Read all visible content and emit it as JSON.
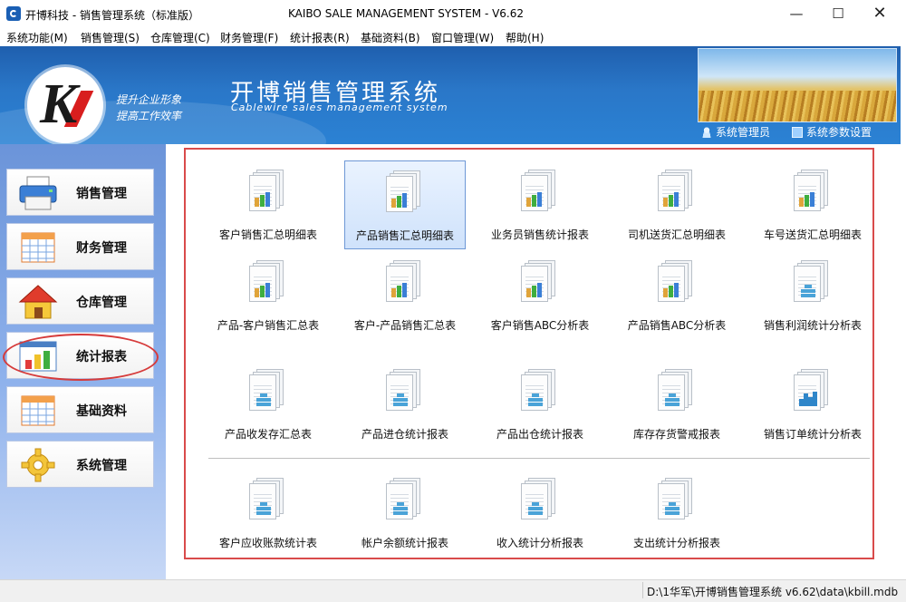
{
  "window": {
    "title_left": "开博科技 - 销售管理系统（标准版）",
    "title_center": "KAIBO SALE MANAGEMENT SYSTEM - V6.62",
    "min_label": "—",
    "max_label": "☐",
    "close_label": "✕"
  },
  "menu": [
    {
      "label": "系统功能(M)"
    },
    {
      "label": "销售管理(S)"
    },
    {
      "label": "仓库管理(C)"
    },
    {
      "label": "财务管理(F)"
    },
    {
      "label": "统计报表(R)"
    },
    {
      "label": "基础资料(B)"
    },
    {
      "label": "窗口管理(W)"
    },
    {
      "label": "帮助(H)"
    }
  ],
  "header": {
    "logo_letter": "K",
    "slogan_line1": "提升企业形象",
    "slogan_line2": "提高工作效率",
    "system_title": "开博销售管理系统",
    "system_subtitle": "Cablewire sales management system",
    "user_label": "系统管理员",
    "settings_label": "系统参数设置"
  },
  "sidebar": {
    "items": [
      {
        "label": "销售管理",
        "icon": "printer-icon"
      },
      {
        "label": "财务管理",
        "icon": "calendar-table-icon"
      },
      {
        "label": "仓库管理",
        "icon": "house-icon"
      },
      {
        "label": "统计报表",
        "icon": "bar-chart-icon",
        "highlighted": true
      },
      {
        "label": "基础资料",
        "icon": "grid-table-icon"
      },
      {
        "label": "系统管理",
        "icon": "gear-icon"
      }
    ]
  },
  "reports": {
    "active_index": 1,
    "items": [
      {
        "label": "客户销售汇总明细表",
        "icon": "color-bar-report-icon"
      },
      {
        "label": "产品销售汇总明细表",
        "icon": "color-bar-report-icon"
      },
      {
        "label": "业务员销售统计报表",
        "icon": "color-bar-report-icon"
      },
      {
        "label": "司机送货汇总明细表",
        "icon": "color-bar-report-icon"
      },
      {
        "label": "车号送货汇总明细表",
        "icon": "color-bar-report-icon"
      },
      {
        "label": "产品-客户销售汇总表",
        "icon": "color-bar-report-icon"
      },
      {
        "label": "客户-产品销售汇总表",
        "icon": "color-bar-report-icon"
      },
      {
        "label": "客户销售ABC分析表",
        "icon": "color-bar-report-icon"
      },
      {
        "label": "产品销售ABC分析表",
        "icon": "color-bar-report-icon"
      },
      {
        "label": "销售利润统计分析表",
        "icon": "blue-grid-report-icon"
      },
      {
        "label": "产品收发存汇总表",
        "icon": "blue-grid-report-icon"
      },
      {
        "label": "产品进仓统计报表",
        "icon": "blue-grid-report-icon"
      },
      {
        "label": "产品出仓统计报表",
        "icon": "blue-grid-report-icon"
      },
      {
        "label": "库存存货警戒报表",
        "icon": "blue-grid-report-icon"
      },
      {
        "label": "销售订单统计分析表",
        "icon": "blue-bar-report-icon"
      },
      {
        "label": "客户应收账款统计表",
        "icon": "blue-grid-report-icon"
      },
      {
        "label": "帐户余额统计报表",
        "icon": "blue-grid-report-icon"
      },
      {
        "label": "收入统计分析报表",
        "icon": "blue-grid-report-icon"
      },
      {
        "label": "支出统计分析报表",
        "icon": "blue-grid-report-icon"
      }
    ]
  },
  "status": {
    "path": "D:\\1华军\\开博销售管理系统 v6.62\\data\\kbill.mdb"
  },
  "colors": {
    "header_blue": "#2a77c8",
    "highlight_red": "#d94b4b",
    "sidebar_blue": "#8fb2ec"
  }
}
